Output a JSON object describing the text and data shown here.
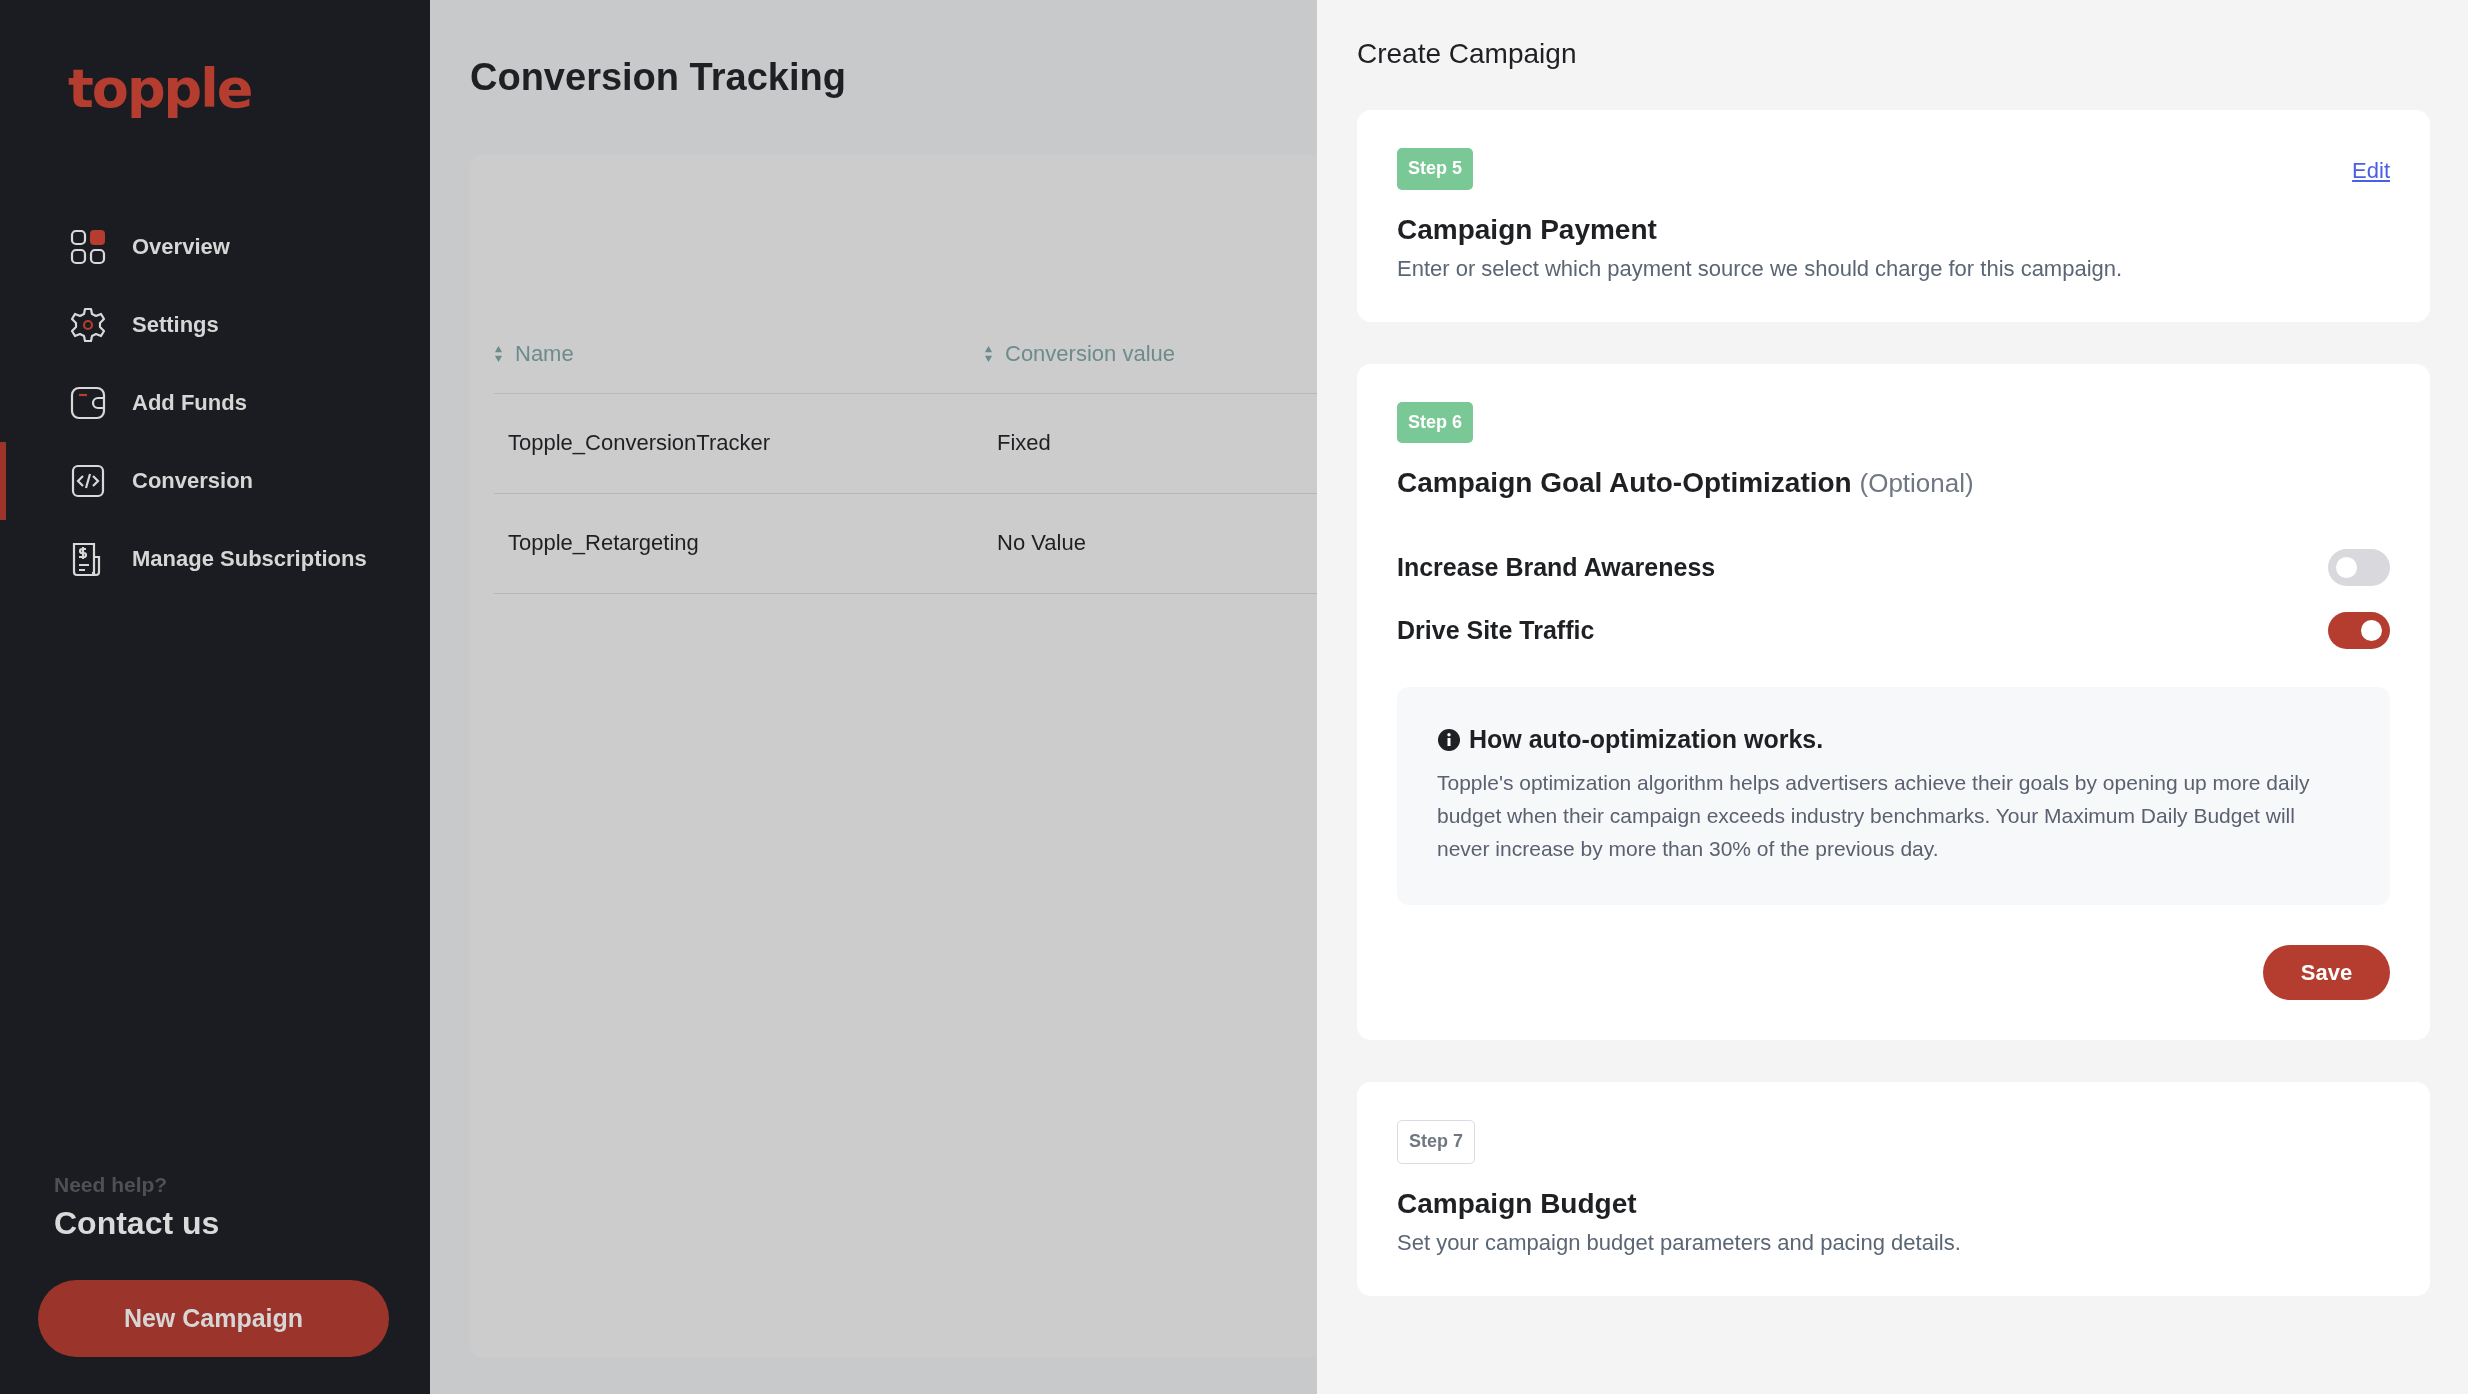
{
  "sidebar": {
    "logo": "topple",
    "nav_items": [
      {
        "label": "Overview",
        "kind": "grid",
        "selected": false
      },
      {
        "label": "Settings",
        "kind": "gear",
        "selected": false
      },
      {
        "label": "Add Funds",
        "kind": "wallet",
        "selected": false
      },
      {
        "label": "Conversion",
        "kind": "code",
        "selected": true
      },
      {
        "label": "Manage Subscriptions",
        "kind": "invoice",
        "selected": false
      }
    ],
    "help": {
      "prompt": "Need help?",
      "link": "Contact us"
    },
    "new_campaign_button": "New Campaign"
  },
  "main": {
    "title": "Conversion Tracking",
    "table": {
      "columns": [
        "Name",
        "Conversion value"
      ],
      "rows": [
        [
          "Topple_ConversionTracker",
          "Fixed"
        ],
        [
          "Topple_Retargeting",
          "No Value"
        ]
      ]
    }
  },
  "drawer": {
    "title": "Create Campaign",
    "steps": [
      {
        "badge": "Step 5",
        "kind": "done",
        "title": "Campaign Payment",
        "description": "Enter or select which payment source we should charge for this campaign.",
        "edit_link": "Edit"
      },
      {
        "badge": "Step 6",
        "kind": "current",
        "title": "Campaign Goal Auto-Optimization",
        "title_note": "(Optional)",
        "goals": [
          {
            "label": "Increase Brand Awareness",
            "on": false
          },
          {
            "label": "Drive Site Traffic",
            "on": true
          }
        ],
        "info": {
          "title": "How auto-optimization works.",
          "body": "Topple's optimization algorithm helps advertisers achieve their goals by opening up more daily budget when their campaign exceeds industry benchmarks. Your Maximum Daily Budget will never increase by more than 30% of the previous day."
        },
        "save_button": "Save"
      },
      {
        "badge": "Step 7",
        "kind": "upcoming",
        "title": "Campaign Budget",
        "description": "Set your campaign budget parameters and pacing details."
      }
    ]
  }
}
